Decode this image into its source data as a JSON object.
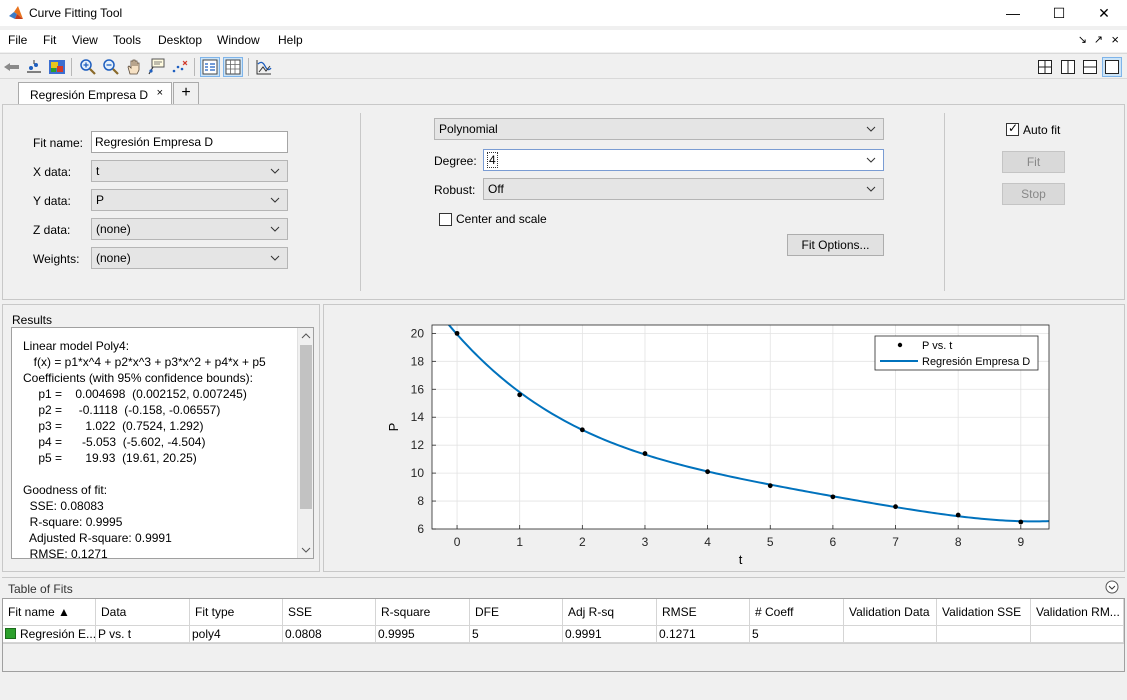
{
  "window": {
    "title": "Curve Fitting Tool",
    "controls": {
      "minimize": "—",
      "maximize": "☐",
      "close": "✕"
    }
  },
  "menu": {
    "items": [
      "File",
      "Fit",
      "View",
      "Tools",
      "Desktop",
      "Window",
      "Help"
    ],
    "right": {
      "undock": "↘",
      "dock": "↗",
      "close": "×"
    }
  },
  "toolbar": {
    "left_icons": [
      "pan-back-icon",
      "data-cursor-icon",
      "colormap-icon",
      "zoom-in-icon",
      "zoom-out-icon",
      "pan-hand-icon",
      "data-cursor-label-icon",
      "exclude-outliers-icon",
      "legend-toggle-icon",
      "grid-toggle-icon",
      "residuals-plot-icon"
    ],
    "right_icons": [
      "tile-grid-icon",
      "tile-columns-icon",
      "tile-rows-icon",
      "single-view-icon"
    ]
  },
  "tabs": [
    {
      "label": "Regresión Empresa D",
      "close": "×",
      "active": true
    }
  ],
  "tab_add": "+",
  "fit": {
    "name_label": "Fit name:",
    "name_value": "Regresión Empresa D",
    "x_label": "X data:",
    "x_value": "t",
    "y_label": "Y data:",
    "y_value": "P",
    "z_label": "Z data:",
    "z_value": "(none)",
    "weights_label": "Weights:",
    "weights_value": "(none)",
    "model_type": "Polynomial",
    "degree_label": "Degree:",
    "degree_value": "4",
    "robust_label": "Robust:",
    "robust_value": "Off",
    "center_scale_label": "Center and scale",
    "center_scale_checked": false,
    "fit_options_button": "Fit Options...",
    "auto_fit_label": "Auto fit",
    "auto_fit_checked": true,
    "fit_button": "Fit",
    "stop_button": "Stop"
  },
  "results": {
    "title": "Results",
    "lines": [
      "Linear model Poly4:",
      "     f(x) = p1*x^4 + p2*x^3 + p3*x^2 + p4*x + p5",
      "Coefficients (with 95% confidence bounds):",
      "       p1 =    0.004698  (0.002152, 0.007245)",
      "       p2 =     -0.1118  (-0.158, -0.06557)",
      "       p3 =       1.022  (0.7524, 1.292)",
      "       p4 =      -5.053  (-5.602, -4.504)",
      "       p5 =       19.93  (19.61, 20.25)",
      "",
      "Goodness of fit:",
      "  SSE: 0.08083",
      "  R-square: 0.9995",
      "  Adjusted R-square: 0.9991",
      "  RMSE: 0.1271"
    ]
  },
  "chart_data": {
    "type": "scatter",
    "xlabel": "t",
    "ylabel": "P",
    "xlim": [
      -0.4,
      9.45
    ],
    "ylim": [
      6,
      20.6
    ],
    "x_ticks": [
      "0",
      "1",
      "2",
      "3",
      "4",
      "5",
      "6",
      "7",
      "8",
      "9"
    ],
    "y_ticks": [
      "6",
      "8",
      "10",
      "12",
      "14",
      "16",
      "18",
      "20"
    ],
    "grid": true,
    "legend_position": "top-right",
    "series": [
      {
        "name": "P vs. t",
        "kind": "points",
        "color": "#000000",
        "x": [
          0,
          1,
          2,
          3,
          4,
          5,
          6,
          7,
          8,
          9
        ],
        "y": [
          20.0,
          15.6,
          13.1,
          11.4,
          10.1,
          9.1,
          8.3,
          7.6,
          7.0,
          6.5
        ]
      },
      {
        "name": "Regresión Empresa D",
        "kind": "curve",
        "color": "#0072bd",
        "coefficients": [
          0.004698,
          -0.1118,
          1.022,
          -5.053,
          19.93
        ]
      }
    ]
  },
  "table": {
    "title": "Table of Fits",
    "collapse": "⌄",
    "columns": [
      "Fit name ▲",
      "Data",
      "Fit type",
      "SSE",
      "R-square",
      "DFE",
      "Adj R-sq",
      "RMSE",
      "# Coeff",
      "Validation Data",
      "Validation SSE",
      "Validation RM..."
    ],
    "rows": [
      [
        "Regresión E...",
        "P vs. t",
        "poly4",
        "0.0808",
        "0.9995",
        "5",
        "0.9991",
        "0.1271",
        "5",
        "",
        "",
        ""
      ]
    ],
    "fit_color": "#2ca02c"
  }
}
